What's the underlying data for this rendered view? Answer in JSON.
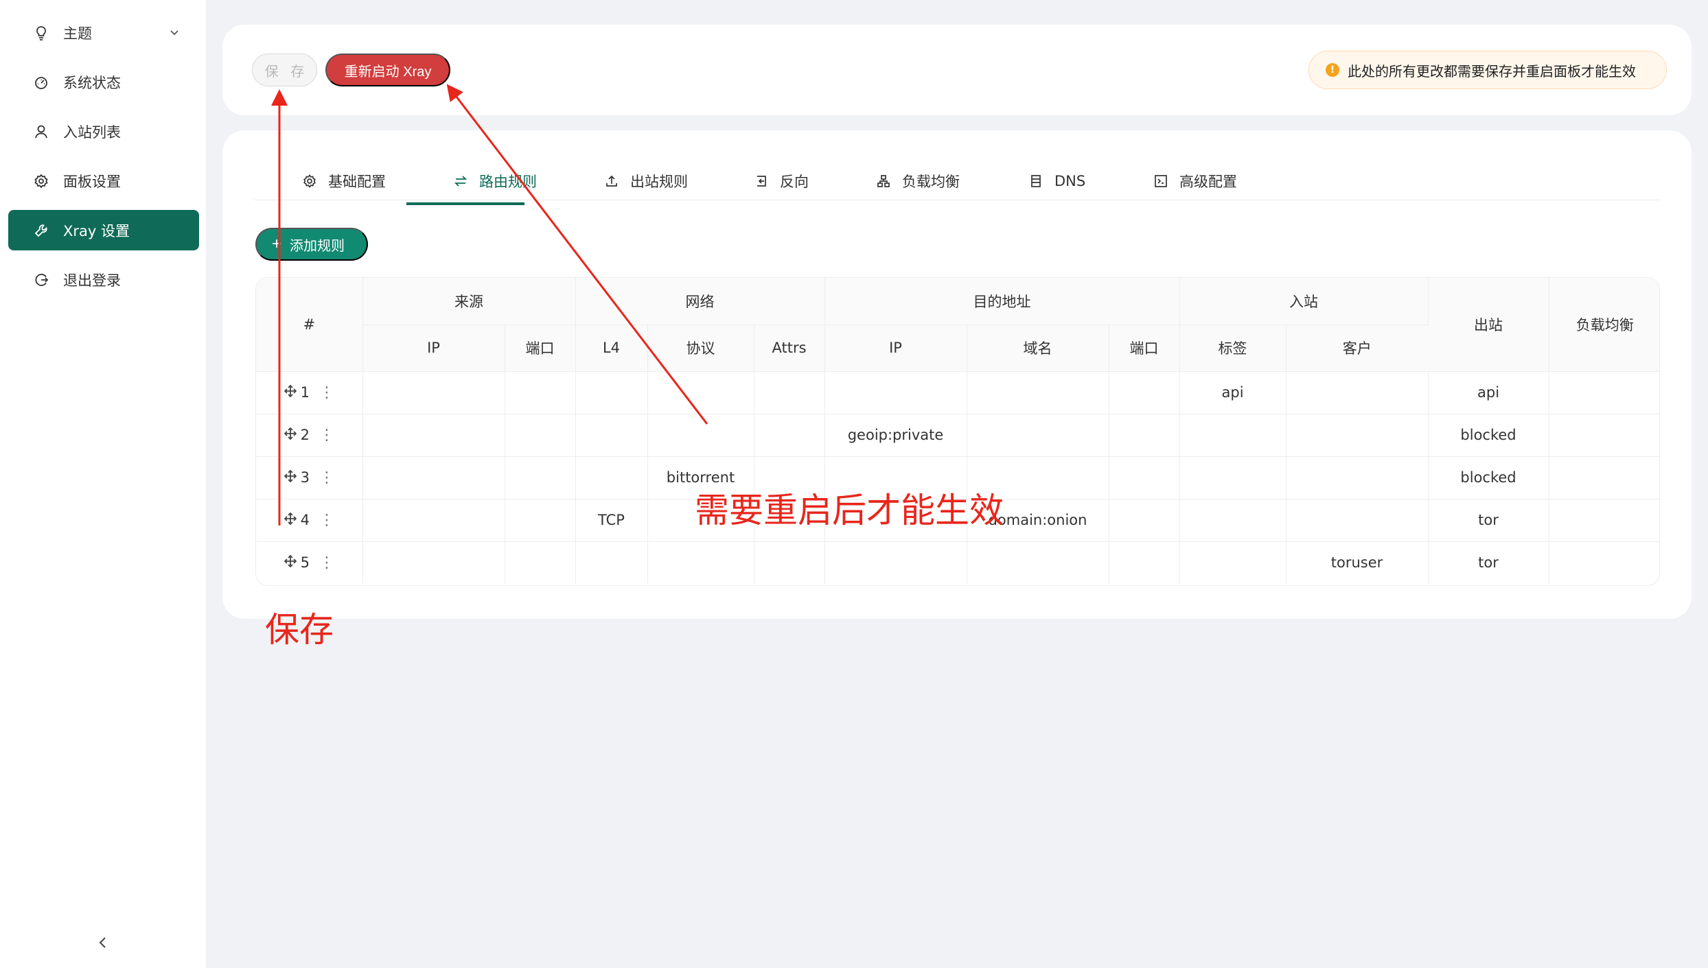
{
  "sidebar": {
    "items": [
      {
        "label": "主题",
        "icon": "bulb-icon",
        "has_chevron": true
      },
      {
        "label": "系统状态",
        "icon": "dashboard-icon"
      },
      {
        "label": "入站列表",
        "icon": "user-icon"
      },
      {
        "label": "面板设置",
        "icon": "gear-icon"
      },
      {
        "label": "Xray 设置",
        "icon": "wrench-icon",
        "active": true
      },
      {
        "label": "退出登录",
        "icon": "logout-icon"
      }
    ],
    "collapse_icon": "chevron-left-icon"
  },
  "toolbar": {
    "save_label": "保 存",
    "restart_label": "重新启动 Xray",
    "notice": "此处的所有更改都需要保存并重启面板才能生效",
    "notice_icon": "!"
  },
  "tabs": [
    {
      "label": "基础配置",
      "icon": "settings-icon"
    },
    {
      "label": "路由规则",
      "icon": "swap-icon",
      "active": true
    },
    {
      "label": "出站规则",
      "icon": "upload-icon"
    },
    {
      "label": "反向",
      "icon": "import-icon"
    },
    {
      "label": "负载均衡",
      "icon": "cluster-icon"
    },
    {
      "label": "DNS",
      "icon": "database-icon"
    },
    {
      "label": "高级配置",
      "icon": "code-icon"
    }
  ],
  "add_rule_label": "添加规则",
  "table": {
    "group_headers": {
      "index": "#",
      "source": "来源",
      "network": "网络",
      "destination": "目的地址",
      "inbound": "入站",
      "outbound": "出站",
      "balancer": "负载均衡"
    },
    "sub_headers": {
      "source_ip": "IP",
      "source_port": "端口",
      "net_l4": "L4",
      "net_protocol": "协议",
      "net_attrs": "Attrs",
      "dest_ip": "IP",
      "dest_domain": "域名",
      "dest_port": "端口",
      "in_tag": "标签",
      "in_user": "客户"
    },
    "rows": [
      {
        "index": "1",
        "source_ip": "",
        "source_port": "",
        "l4": "",
        "protocol": "",
        "attrs": "",
        "dest_ip": "",
        "domain": "",
        "dest_port": "",
        "in_tag": "api",
        "in_user": "",
        "outbound": "api",
        "balancer": ""
      },
      {
        "index": "2",
        "source_ip": "",
        "source_port": "",
        "l4": "",
        "protocol": "",
        "attrs": "",
        "dest_ip": "geoip:private",
        "domain": "",
        "dest_port": "",
        "in_tag": "",
        "in_user": "",
        "outbound": "blocked",
        "balancer": ""
      },
      {
        "index": "3",
        "source_ip": "",
        "source_port": "",
        "l4": "",
        "protocol": "bittorrent",
        "attrs": "",
        "dest_ip": "",
        "domain": "",
        "dest_port": "",
        "in_tag": "",
        "in_user": "",
        "outbound": "blocked",
        "balancer": ""
      },
      {
        "index": "4",
        "source_ip": "",
        "source_port": "",
        "l4": "TCP",
        "protocol": "",
        "attrs": "",
        "dest_ip": "",
        "domain": "domain:onion",
        "dest_port": "",
        "in_tag": "",
        "in_user": "",
        "outbound": "tor",
        "balancer": ""
      },
      {
        "index": "5",
        "source_ip": "",
        "source_port": "",
        "l4": "",
        "protocol": "",
        "attrs": "",
        "dest_ip": "",
        "domain": "",
        "dest_port": "",
        "in_tag": "",
        "in_user": "toruser",
        "outbound": "tor",
        "balancer": ""
      }
    ]
  },
  "annotations": {
    "save_note": "保存",
    "restart_note": "需要重启后才能生效",
    "color": "#e8261c"
  },
  "colors": {
    "accent": "#0f6b57",
    "danger": "#d23d3d",
    "add_button": "#128a72",
    "warning": "#f7a21b"
  }
}
